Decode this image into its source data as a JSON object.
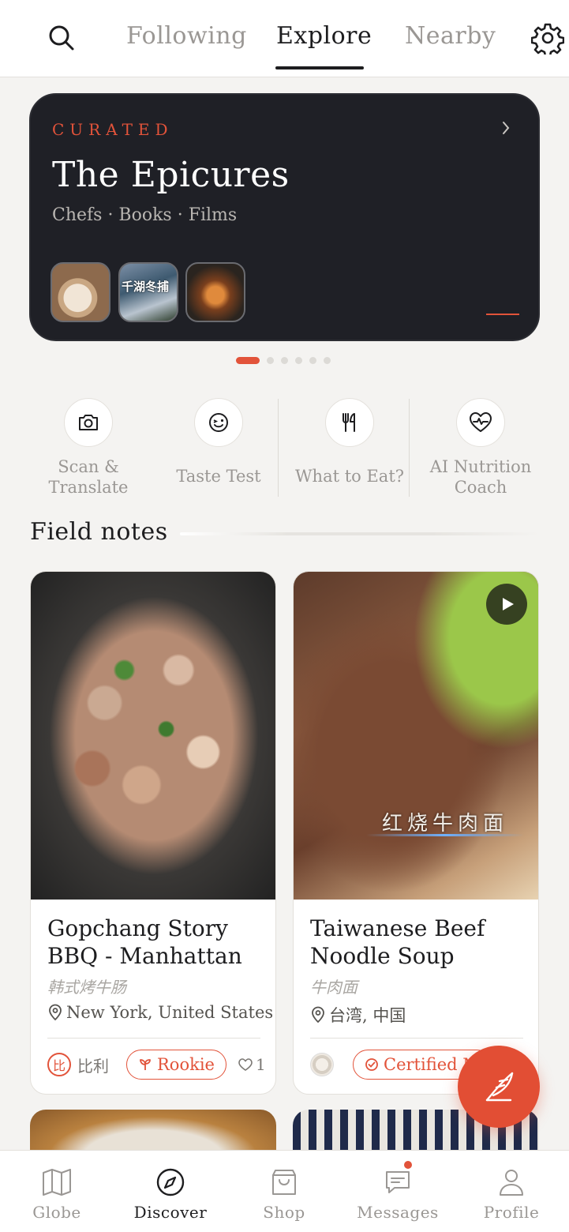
{
  "header": {
    "tabs": [
      {
        "label": "Following",
        "active": false
      },
      {
        "label": "Explore",
        "active": true
      },
      {
        "label": "Nearby",
        "active": false
      }
    ]
  },
  "banner": {
    "eyebrow": "CURATED",
    "title": "The Epicures",
    "subtitle": "Chefs · Books · Films",
    "thumb_text": "千湖冬捕",
    "page_count": 6,
    "active_page": 1
  },
  "quick_actions": [
    {
      "label_line1": "Scan &",
      "label_line2": "Translate",
      "icon": "camera-icon"
    },
    {
      "label_line1": "Taste Test",
      "label_line2": "",
      "icon": "wink-face-icon"
    },
    {
      "label_line1": "What to Eat?",
      "label_line2": "",
      "icon": "fork-knife-icon"
    },
    {
      "label_line1": "AI Nutrition",
      "label_line2": "Coach",
      "icon": "heart-pulse-icon"
    }
  ],
  "field_notes": {
    "title": "Field notes",
    "cards": [
      {
        "title": "Gopchang Story BBQ - Manhattan",
        "subtitle": "韩式烤牛肠",
        "location": "New York, United States",
        "author_initial": "比",
        "author_name": "比利",
        "badge": "Rookie",
        "likes": "1"
      },
      {
        "title": "Taiwanese Beef Noodle Soup",
        "subtitle": "牛肉面",
        "location": "台湾, 中国",
        "photo_caption": "红烧牛肉面",
        "badge": "Certified M",
        "has_video": true
      }
    ]
  },
  "bottom_nav": [
    {
      "label": "Globe",
      "icon": "map-icon",
      "active": false
    },
    {
      "label": "Discover",
      "icon": "compass-icon",
      "active": true
    },
    {
      "label": "Shop",
      "icon": "shopping-bag-icon",
      "active": false
    },
    {
      "label": "Messages",
      "icon": "chat-bubble-icon",
      "active": false,
      "has_notification": true
    },
    {
      "label": "Profile",
      "icon": "person-icon",
      "active": false
    }
  ],
  "colors": {
    "accent": "#e2533a",
    "banner_bg": "#1f2026",
    "page_bg": "#f4f3f1"
  }
}
